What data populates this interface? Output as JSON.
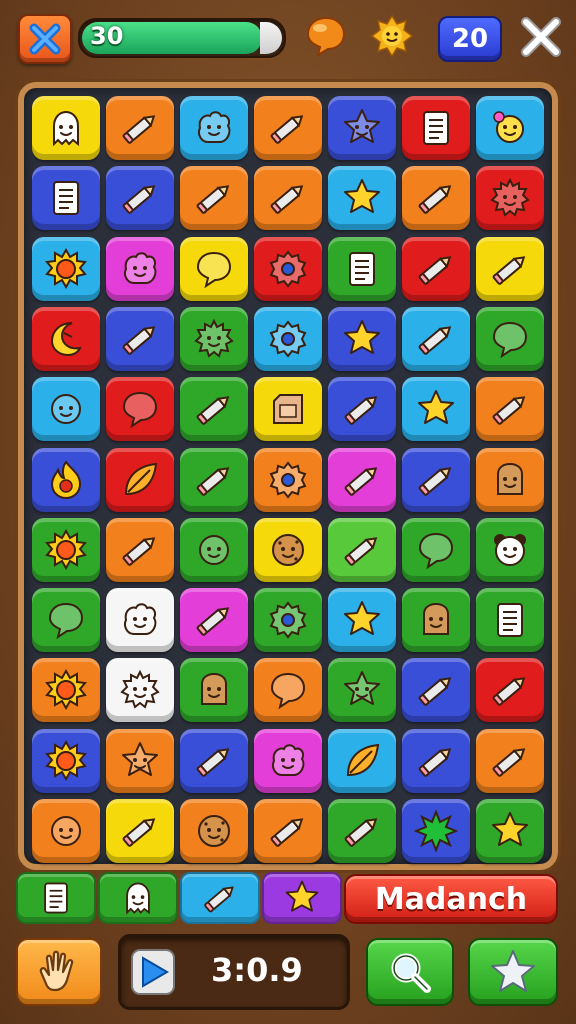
{
  "top_bar": {
    "close_icon": "close-x-icon",
    "progress_value": 30,
    "progress_label": "30",
    "progress_fraction": 0.88,
    "chat_icon": "chat-bubble-icon",
    "sun_icon": "sun-face-icon",
    "level": "20",
    "exit_icon": "cross-icon"
  },
  "colors": {
    "yellow": "#f5d90a",
    "orange": "#f2801c",
    "sky": "#2bb0ea",
    "blue": "#3a4fd8",
    "red": "#e01c1c",
    "green": "#2fa82a",
    "lime": "#58c93a",
    "magenta": "#e43ed8",
    "purple": "#9a3ae0",
    "white": "#f6f6f6"
  },
  "board": {
    "rows": 11,
    "cols": 7,
    "tiles": [
      [
        [
          "yellow",
          "ghost"
        ],
        [
          "orange",
          "pencil"
        ],
        [
          "sky",
          "blob"
        ],
        [
          "orange",
          "pencil"
        ],
        [
          "blue",
          "star-face"
        ],
        [
          "red",
          "note"
        ],
        [
          "sky",
          "face-bow"
        ]
      ],
      [
        [
          "blue",
          "note"
        ],
        [
          "blue",
          "pencil"
        ],
        [
          "orange",
          "pencil"
        ],
        [
          "orange",
          "pencil"
        ],
        [
          "sky",
          "star"
        ],
        [
          "orange",
          "pencil"
        ],
        [
          "red",
          "spiky"
        ]
      ],
      [
        [
          "sky",
          "sun"
        ],
        [
          "magenta",
          "blob"
        ],
        [
          "yellow",
          "speech"
        ],
        [
          "red",
          "gear"
        ],
        [
          "green",
          "note"
        ],
        [
          "red",
          "pencil"
        ],
        [
          "yellow",
          "pencil"
        ]
      ],
      [
        [
          "red",
          "moon"
        ],
        [
          "blue",
          "pencil"
        ],
        [
          "green",
          "spiky"
        ],
        [
          "sky",
          "gear"
        ],
        [
          "blue",
          "star"
        ],
        [
          "sky",
          "pencil"
        ],
        [
          "green",
          "speech"
        ]
      ],
      [
        [
          "sky",
          "smile"
        ],
        [
          "red",
          "speech"
        ],
        [
          "green",
          "pencil"
        ],
        [
          "yellow",
          "card"
        ],
        [
          "blue",
          "pencil"
        ],
        [
          "sky",
          "star"
        ],
        [
          "orange",
          "pencil"
        ]
      ],
      [
        [
          "blue",
          "flame"
        ],
        [
          "red",
          "leaf"
        ],
        [
          "green",
          "pencil"
        ],
        [
          "orange",
          "gear"
        ],
        [
          "magenta",
          "pencil"
        ],
        [
          "blue",
          "pencil"
        ],
        [
          "orange",
          "toast"
        ]
      ],
      [
        [
          "green",
          "sun"
        ],
        [
          "orange",
          "pencil"
        ],
        [
          "green",
          "smile"
        ],
        [
          "yellow",
          "cookie"
        ],
        [
          "lime",
          "pencil"
        ],
        [
          "green",
          "speech"
        ],
        [
          "green",
          "panda"
        ]
      ],
      [
        [
          "green",
          "speech"
        ],
        [
          "white",
          "blob"
        ],
        [
          "magenta",
          "pencil"
        ],
        [
          "green",
          "gear"
        ],
        [
          "sky",
          "star"
        ],
        [
          "green",
          "toast"
        ],
        [
          "green",
          "note"
        ]
      ],
      [
        [
          "orange",
          "sun"
        ],
        [
          "white",
          "spiky"
        ],
        [
          "green",
          "toast"
        ],
        [
          "orange",
          "speech"
        ],
        [
          "green",
          "star-face"
        ],
        [
          "blue",
          "pencil"
        ],
        [
          "red",
          "pencil"
        ]
      ],
      [
        [
          "blue",
          "sun"
        ],
        [
          "orange",
          "star-face"
        ],
        [
          "blue",
          "pencil"
        ],
        [
          "magenta",
          "blob"
        ],
        [
          "sky",
          "leaf"
        ],
        [
          "blue",
          "pencil"
        ],
        [
          "orange",
          "pencil"
        ]
      ],
      [
        [
          "orange",
          "smile"
        ],
        [
          "yellow",
          "pencil"
        ],
        [
          "orange",
          "cookie"
        ],
        [
          "orange",
          "pencil"
        ],
        [
          "green",
          "pencil"
        ],
        [
          "blue",
          "burst"
        ],
        [
          "green",
          "star"
        ]
      ]
    ]
  },
  "tray": [
    [
      "green",
      "note"
    ],
    [
      "green",
      "ghost"
    ],
    [
      "sky",
      "pencil"
    ],
    [
      "purple",
      "star"
    ]
  ],
  "name_button": "Madanch",
  "bottom_bar": {
    "hand_icon": "hand-icon",
    "play_icon": "play-icon",
    "timer": "3:0.9",
    "search_icon": "search-icon",
    "star_icon": "star-icon"
  }
}
